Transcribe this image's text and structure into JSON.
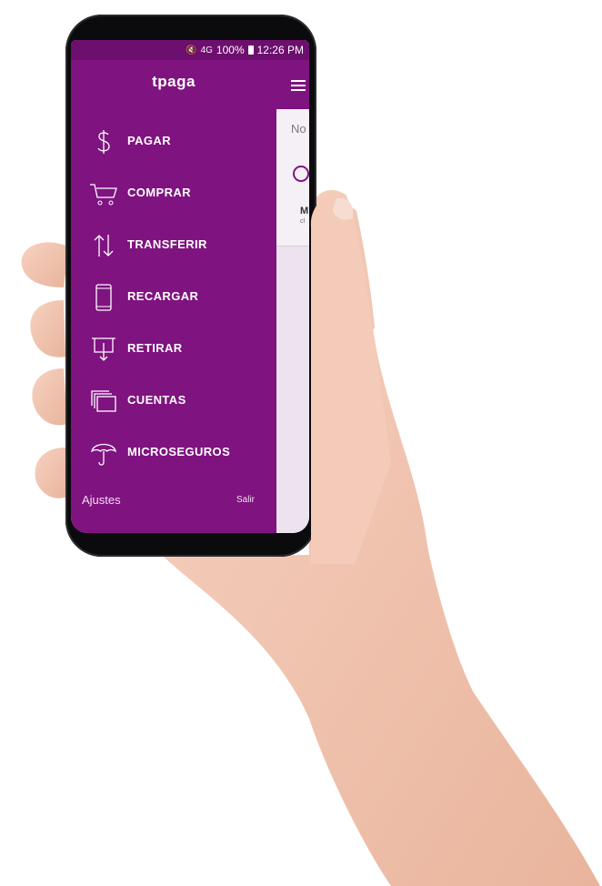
{
  "statusbar": {
    "mute": "🔇",
    "network": "4G",
    "battery": "100%",
    "time": "12:26 PM"
  },
  "drawer": {
    "logo": "tpaga",
    "items": [
      {
        "label": "PAGAR",
        "icon": "dollar-icon"
      },
      {
        "label": "COMPRAR",
        "icon": "cart-icon"
      },
      {
        "label": "TRANSFERIR",
        "icon": "transfer-arrows-icon"
      },
      {
        "label": "RECARGAR",
        "icon": "phone-icon"
      },
      {
        "label": "RETIRAR",
        "icon": "withdraw-icon"
      },
      {
        "label": "CUENTAS",
        "icon": "accounts-icon"
      },
      {
        "label": "MICROSEGUROS",
        "icon": "umbrella-icon"
      }
    ],
    "footer": {
      "settings": "Ajustes",
      "logout": "Salir"
    }
  },
  "content": {
    "partial_text": "No",
    "row_initial": "M",
    "row_sub": "cl"
  },
  "colors": {
    "drawer": "#7f1380",
    "statusbar": "#6d0f6e",
    "background": "#ede3ef"
  }
}
